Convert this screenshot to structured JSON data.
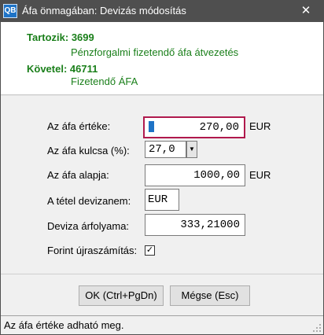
{
  "window": {
    "app_icon_text": "QB",
    "title": "Áfa önmagában: Devizás módosítás",
    "close_glyph": "✕"
  },
  "info": {
    "tartozik_label": "Tartozik: 3699",
    "tartozik_desc": "Pénzforgalmi fizetendő áfa átvezetés",
    "kovetel_label": "Követel: 46711",
    "kovetel_desc": "Fizetendő ÁFA"
  },
  "form": {
    "afa_erteke_label": "Az áfa értéke:",
    "afa_erteke_value": "270,00",
    "afa_erteke_unit": "EUR",
    "afa_kulcsa_label": "Az áfa kulcsa (%):",
    "afa_kulcsa_value": "27,0",
    "afa_alapja_label": "Az áfa alapja:",
    "afa_alapja_value": "1000,00",
    "afa_alapja_unit": "EUR",
    "devizanem_label": "A tétel devizanem:",
    "devizanem_value": "EUR",
    "arfolyam_label": "Deviza árfolyama:",
    "arfolyam_value": "333,21000",
    "forint_label": "Forint újraszámítás:",
    "forint_checked": "✓"
  },
  "buttons": {
    "ok_label": "OK (Ctrl+PgDn)",
    "cancel_label": "Mégse (Esc)"
  },
  "status": {
    "text": "Az áfa értéke adható meg."
  },
  "colors": {
    "titlebar": "#4f4f4f",
    "label_green": "#1a7f1a",
    "active_border": "#b0194d",
    "caret": "#1e73c6"
  },
  "icons": [
    "app-icon",
    "close-icon",
    "dropdown-arrow-icon",
    "checkmark-icon",
    "resize-grip-icon"
  ]
}
